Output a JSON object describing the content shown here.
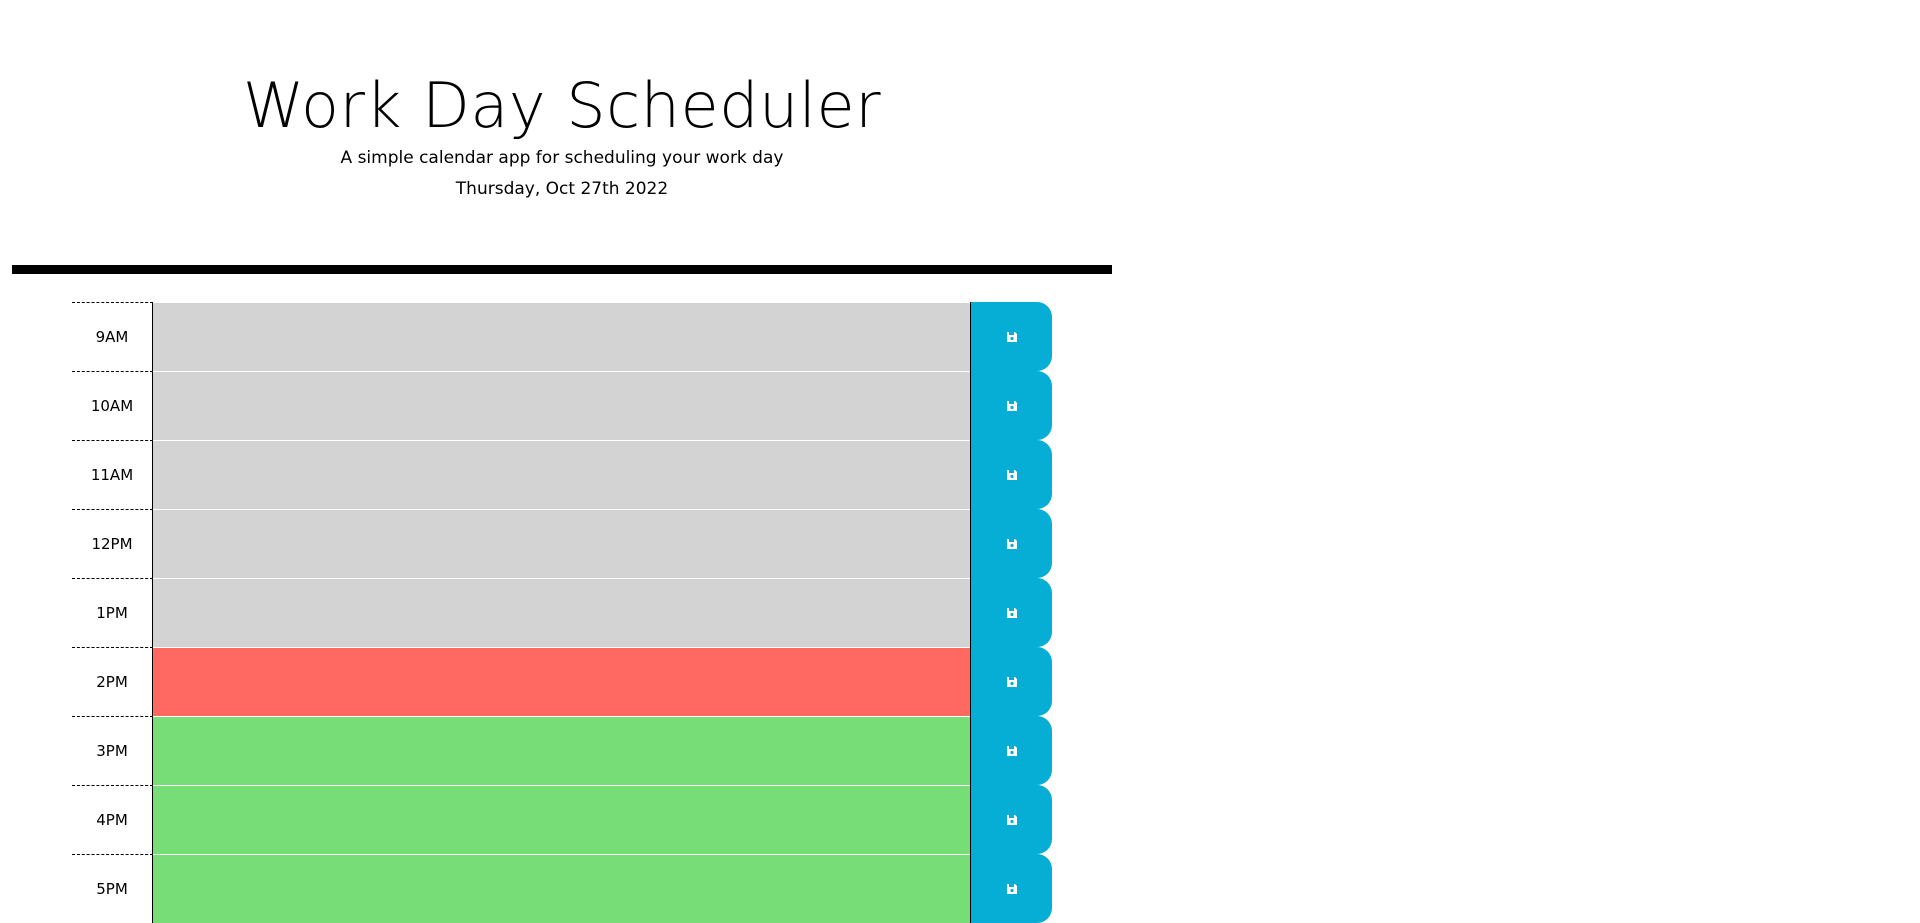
{
  "header": {
    "title": "Work Day Scheduler",
    "subtitle": "A simple calendar app for scheduling your work day",
    "current_day": "Thursday, Oct 27th 2022"
  },
  "colors": {
    "past": "#d3d3d3",
    "present": "#ff6961",
    "future": "#77dd77",
    "save_button": "#06aed5"
  },
  "time_blocks": [
    {
      "hour": "9AM",
      "status": "past",
      "text": ""
    },
    {
      "hour": "10AM",
      "status": "past",
      "text": ""
    },
    {
      "hour": "11AM",
      "status": "past",
      "text": ""
    },
    {
      "hour": "12PM",
      "status": "past",
      "text": ""
    },
    {
      "hour": "1PM",
      "status": "past",
      "text": ""
    },
    {
      "hour": "2PM",
      "status": "present",
      "text": ""
    },
    {
      "hour": "3PM",
      "status": "future",
      "text": ""
    },
    {
      "hour": "4PM",
      "status": "future",
      "text": ""
    },
    {
      "hour": "5PM",
      "status": "future",
      "text": ""
    }
  ],
  "icons": {
    "save": "save-icon"
  }
}
